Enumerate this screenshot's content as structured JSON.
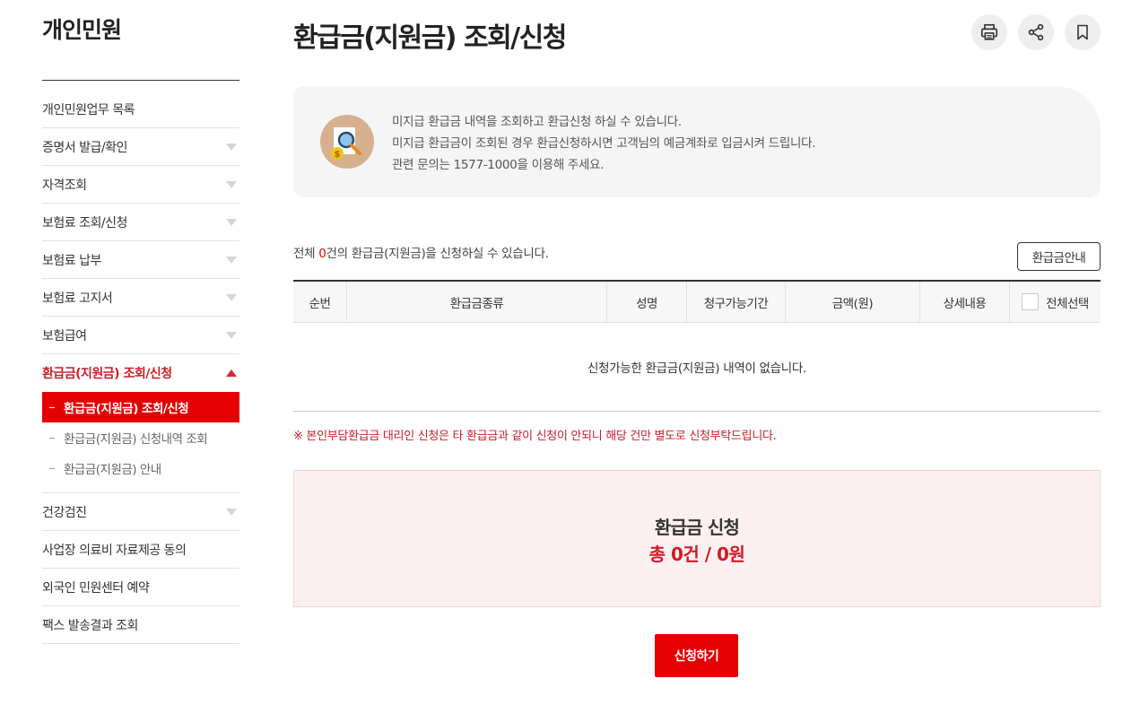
{
  "sidebar": {
    "title": "개인민원",
    "items": [
      {
        "label": "개인민원업무 목록",
        "has_arrow": false
      },
      {
        "label": "증명서 발급/확인",
        "has_arrow": true
      },
      {
        "label": "자격조회",
        "has_arrow": true
      },
      {
        "label": "보험료 조회/신청",
        "has_arrow": true
      },
      {
        "label": "보험료 납부",
        "has_arrow": true
      },
      {
        "label": "보험료 고지서",
        "has_arrow": true
      },
      {
        "label": "보험급여",
        "has_arrow": true
      },
      {
        "label": "환급금(지원금) 조회/신청",
        "has_arrow": true,
        "active": true
      }
    ],
    "sub_items": [
      {
        "label": "환급금(지원금) 조회/신청",
        "active": true
      },
      {
        "label": "환급금(지원금) 신청내역 조회",
        "active": false
      },
      {
        "label": "환급금(지원금) 안내",
        "active": false
      }
    ],
    "items_after": [
      {
        "label": "건강검진",
        "has_arrow": true
      },
      {
        "label": "사업장 의료비 자료제공 동의",
        "has_arrow": false
      },
      {
        "label": "외국인 민원센터 예약",
        "has_arrow": false
      },
      {
        "label": "팩스 발송결과 조회",
        "has_arrow": false
      }
    ]
  },
  "page": {
    "title": "환급금(지원금) 조회/신청"
  },
  "toolbar": {
    "icons": [
      "printer-icon",
      "share-icon",
      "bookmark-icon"
    ]
  },
  "info": {
    "lines": [
      "미지급 환급금 내역을 조회하고 환급신청 하실 수 있습니다.",
      "미지급 환급금이 조회된 경우 환급신청하시면 고객님의 예금계좌로 입금시켜 드립니다.",
      "관련 문의는 1577-1000을 이용해 주세요."
    ]
  },
  "count": {
    "prefix": "전체 ",
    "number": "0",
    "suffix": "건의 환급금(지원금)을 신청하실 수 있습니다."
  },
  "guide_button": "환급금안내",
  "table": {
    "headers": [
      "순번",
      "환급금종류",
      "성명",
      "청구가능기간",
      "금액(원)",
      "상세내용",
      "전체선택"
    ],
    "empty_message": "신청가능한 환급금(지원금) 내역이 없습니다."
  },
  "notice": "※ 본인부담환급금 대리인 신청은 타 환급금과 같이 신청이 안되니 해당 건만 별도로 신청부탁드립니다.",
  "summary": {
    "title": "환급금 신청",
    "total": "총 0건 / 0원"
  },
  "apply_button": "신청하기",
  "colors": {
    "accent": "#e40001",
    "accent_text": "#cc1d28",
    "summary_bg": "#fdf0f1"
  }
}
